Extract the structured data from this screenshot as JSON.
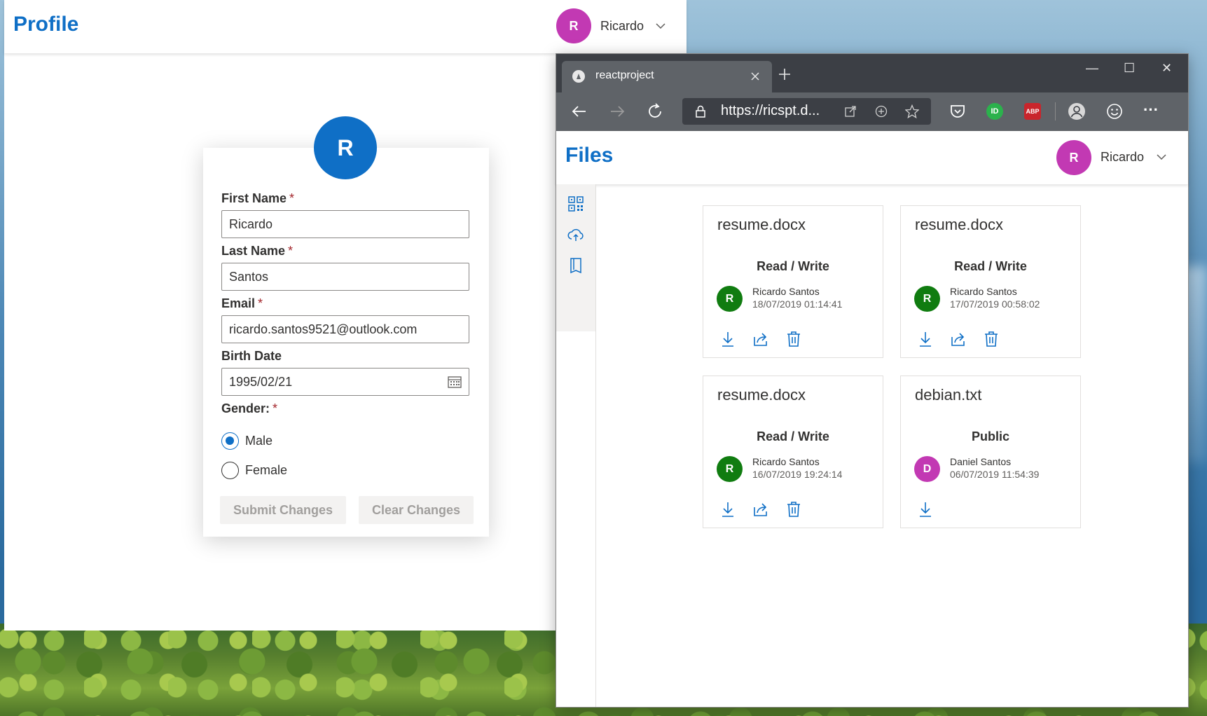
{
  "profile_window": {
    "title": "Profile",
    "user": {
      "initial": "R",
      "name": "Ricardo",
      "avatar_color": "#c239b3"
    },
    "card_avatar": {
      "initial": "R",
      "color": "#0f6fc6"
    },
    "fields": {
      "first_name": {
        "label": "First Name",
        "required": "*",
        "value": "Ricardo"
      },
      "last_name": {
        "label": "Last Name",
        "required": "*",
        "value": "Santos"
      },
      "email": {
        "label": "Email",
        "required": "*",
        "value": "ricardo.santos9521@outlook.com"
      },
      "birth_date": {
        "label": "Birth Date",
        "value": "1995/02/21"
      },
      "gender": {
        "label": "Gender:",
        "required": "*",
        "options": [
          {
            "label": "Male",
            "selected": true
          },
          {
            "label": "Female",
            "selected": false
          }
        ]
      }
    },
    "buttons": {
      "submit": "Submit Changes",
      "clear": "Clear Changes"
    }
  },
  "browser": {
    "tab_title": "reactproject",
    "url": "https://ricspt.d...",
    "window_controls": {
      "minimize": "—",
      "maximize": "☐",
      "close": "✕"
    },
    "extensions": [
      "pocket-icon",
      "id-extension-icon",
      "abp-icon"
    ],
    "abp_label": "ABP",
    "id_label": "ID",
    "menu_label": "···"
  },
  "files_page": {
    "title": "Files",
    "user": {
      "initial": "R",
      "name": "Ricardo",
      "avatar_color": "#c239b3"
    },
    "sidebar_icons": [
      "qr-code-icon",
      "cloud-upload-icon",
      "book-icon"
    ],
    "files": [
      {
        "name": "resume.docx",
        "permission": "Read / Write",
        "owner": "Ricardo Santos",
        "timestamp": "18/07/2019 01:14:41",
        "initial": "R",
        "avatar_color": "#107c10",
        "actions": [
          "download",
          "share",
          "delete"
        ]
      },
      {
        "name": "resume.docx",
        "permission": "Read / Write",
        "owner": "Ricardo Santos",
        "timestamp": "17/07/2019 00:58:02",
        "initial": "R",
        "avatar_color": "#107c10",
        "actions": [
          "download",
          "share",
          "delete"
        ]
      },
      {
        "name": "resume.docx",
        "permission": "Read / Write",
        "owner": "Ricardo Santos",
        "timestamp": "16/07/2019 19:24:14",
        "initial": "R",
        "avatar_color": "#107c10",
        "actions": [
          "download",
          "share",
          "delete"
        ]
      },
      {
        "name": "debian.txt",
        "permission": "Public",
        "owner": "Daniel Santos",
        "timestamp": "06/07/2019 11:54:39",
        "initial": "D",
        "avatar_color": "#c239b3",
        "actions": [
          "download"
        ]
      }
    ]
  },
  "colors": {
    "accent": "#0f6fc6",
    "danger": "#a4262c",
    "icon_blue": "#0f6fc6"
  }
}
